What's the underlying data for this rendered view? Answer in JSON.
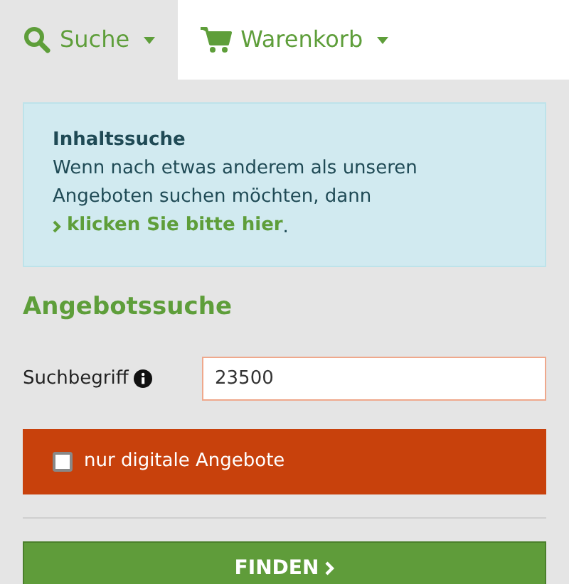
{
  "tabs": [
    {
      "kind": "search",
      "label": "Suche",
      "selected": true
    },
    {
      "kind": "cart",
      "label": "Warenkorb",
      "selected": false
    }
  ],
  "info": {
    "title": "Inhaltssuche",
    "text": "Wenn nach etwas anderem als unseren Angeboten suchen möchten, dann ",
    "link": "klicken Sie bitte hier",
    "text_after": "."
  },
  "heading": "Angebotssuche",
  "search_field": {
    "label": "Suchbegriff",
    "value": "23500"
  },
  "filter": {
    "label": "nur digitale Angebote",
    "checked": false
  },
  "submit": {
    "label": "FINDEN"
  }
}
